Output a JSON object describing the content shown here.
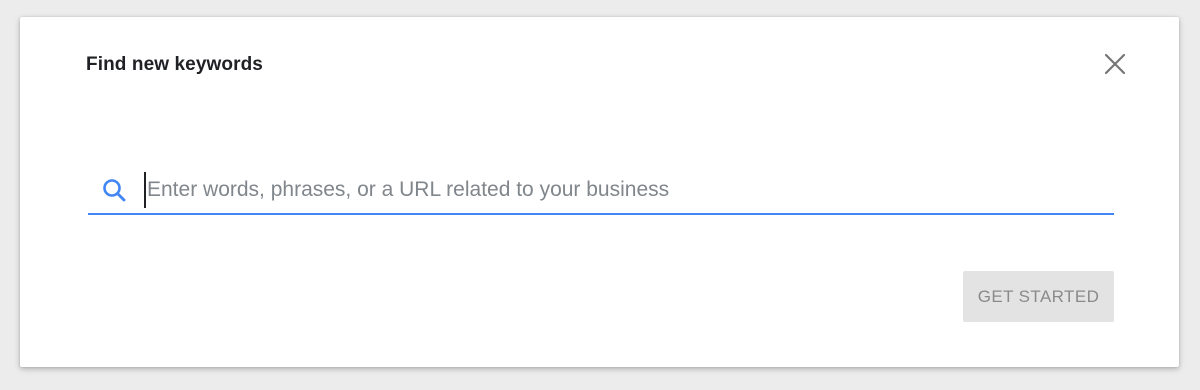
{
  "dialog": {
    "title": "Find new keywords",
    "close_icon": "close-icon",
    "search": {
      "icon": "search-icon",
      "placeholder": "Enter words, phrases, or a URL related to your business",
      "value": ""
    },
    "primary_button": {
      "label": "GET STARTED",
      "state": "disabled"
    }
  },
  "colors": {
    "accent": "#4285f4",
    "title_text": "#202124",
    "placeholder_text": "#80868b",
    "button_bg_disabled": "#e3e3e3",
    "button_text_disabled": "#8a8a8a",
    "close_icon": "#757575"
  }
}
